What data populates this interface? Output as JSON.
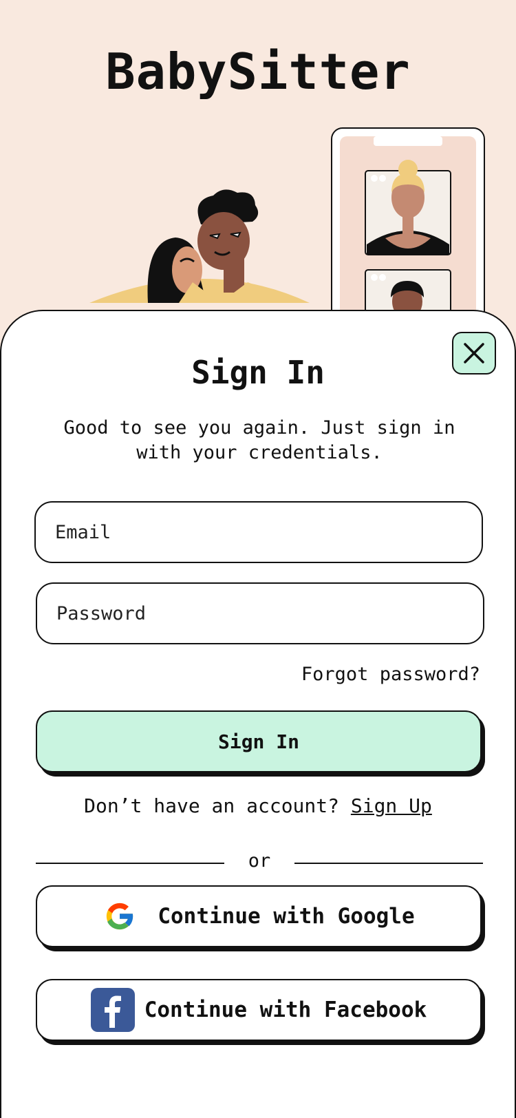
{
  "app": {
    "title": "BabySitter"
  },
  "sheet": {
    "title": "Sign In",
    "subtitle": "Good to see you again. Just sign in with your credentials."
  },
  "form": {
    "email_placeholder": "Email",
    "email_value": "",
    "password_placeholder": "Password",
    "password_value": "",
    "forgot_label": "Forgot password?",
    "submit_label": "Sign In"
  },
  "signup": {
    "prompt": "Don’t have an account?",
    "link_label": "Sign Up"
  },
  "divider": {
    "label": "or"
  },
  "social": {
    "google_label": "Continue with Google",
    "facebook_label": "Continue with Facebook"
  },
  "colors": {
    "background": "#f9e9df",
    "accent": "#c9f4e0",
    "facebook": "#3b5998"
  }
}
